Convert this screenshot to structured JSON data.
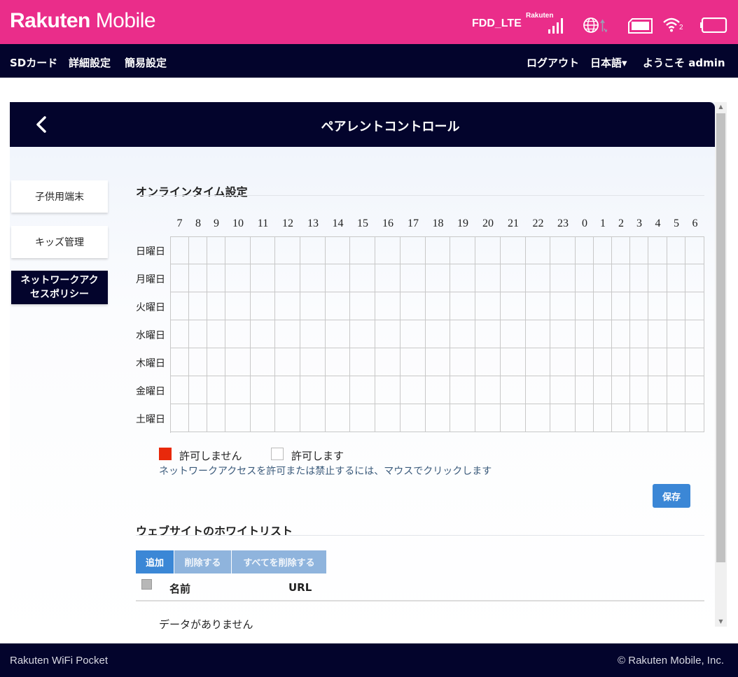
{
  "brand": {
    "name_bold": "Rakuten",
    "name_light": " Mobile"
  },
  "status": {
    "network_type": "FDD_LTE",
    "carrier": "Rakuten",
    "signal_bars": 4,
    "wifi_clients": "2",
    "icons": [
      "signal-icon",
      "globe-icon",
      "sim-icon",
      "wifi-icon",
      "battery-icon"
    ]
  },
  "nav": {
    "sd_card": "SDカード",
    "advanced": "詳細設定",
    "simple": "簡易設定",
    "logout": "ログアウト",
    "language": "日本語▾",
    "welcome": "ようこそ  admin"
  },
  "panel": {
    "title": "ペアレントコントロール"
  },
  "menu": {
    "items": [
      "子供用端末",
      "キッズ管理",
      "ネットワークアクセスポリシー"
    ],
    "active_line1": "ネットワークアク",
    "active_line2": "セスポリシー"
  },
  "schedule": {
    "title": "オンラインタイム設定",
    "hours": [
      "7",
      "8",
      "9",
      "10",
      "11",
      "12",
      "13",
      "14",
      "15",
      "16",
      "17",
      "18",
      "19",
      "20",
      "21",
      "22",
      "23",
      "0",
      "1",
      "2",
      "3",
      "4",
      "5",
      "6"
    ],
    "days": [
      "日曜日",
      "月曜日",
      "火曜日",
      "水曜日",
      "木曜日",
      "金曜日",
      "土曜日"
    ],
    "legend_deny": "許可しません",
    "legend_allow": "許可します",
    "hint": "ネットワークアクセスを許可または禁止するには、マウスでクリックします",
    "save_label": "保存",
    "deny_color": "#e8290b"
  },
  "whitelist": {
    "title": "ウェブサイトのホワイトリスト",
    "add_label": "追加",
    "delete_label": "削除する",
    "delete_all_label": "すべてを削除する",
    "col_name": "名前",
    "col_url": "URL",
    "empty": "データがありません"
  },
  "footer": {
    "left": "Rakuten WiFi Pocket",
    "right": "© Rakuten Mobile, Inc."
  },
  "colors": {
    "brand_pink": "#ea2d8a",
    "navy": "#03042c",
    "accent_blue": "#3b87d6"
  }
}
